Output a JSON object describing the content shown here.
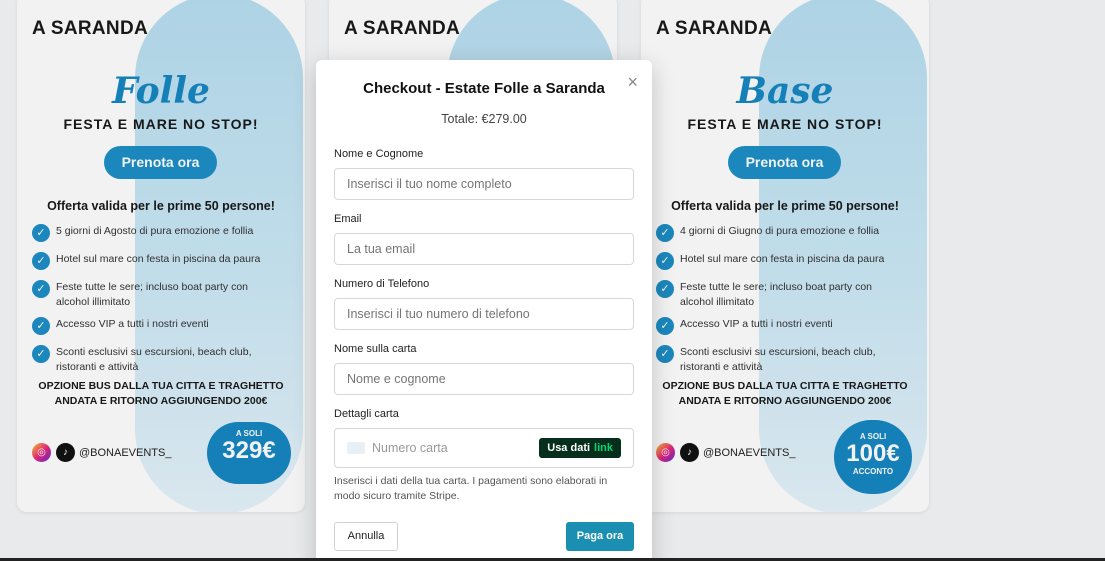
{
  "cards": [
    {
      "head": "A SARANDA",
      "script_title": "Folle",
      "tagline": "FESTA E MARE NO STOP!",
      "cta": "Prenota ora",
      "offer": "Offerta valida per le prime 50 persone!",
      "features": [
        "5 giorni di Agosto di pura emozione e follia",
        "Hotel sul mare con festa in piscina da paura",
        "Feste tutte le sere; incluso boat party con alcohol illimitato",
        "Accesso VIP a tutti i nostri eventi",
        "Sconti esclusivi su escursioni, beach club, ristoranti e attività"
      ],
      "bus": "OPZIONE BUS DALLA TUA CITTA E TRAGHETTO ANDATA E RITORNO AGGIUNGENDO 200€",
      "social": "@BONAEVENTS_",
      "price_small": "A SOLI",
      "price": "329€",
      "price_sub": ""
    },
    {
      "head": "A SARANDA"
    },
    {
      "head": "A SARANDA",
      "script_title": "Base",
      "tagline": "FESTA E MARE NO STOP!",
      "cta": "Prenota ora",
      "offer": "Offerta valida per le prime 50 persone!",
      "features": [
        "4 giorni di Giugno di pura emozione e follia",
        "Hotel sul mare con festa in piscina da paura",
        "Feste tutte le sere; incluso boat party con alcohol illimitato",
        "Accesso VIP a tutti i nostri eventi",
        "Sconti esclusivi su escursioni, beach club, ristoranti e attività"
      ],
      "bus": "OPZIONE BUS DALLA TUA CITTA E TRAGHETTO ANDATA E RITORNO AGGIUNGENDO 200€",
      "social": "@BONAEVENTS_",
      "price_small": "A SOLI",
      "price": "100€",
      "price_sub": "ACCONTO"
    }
  ],
  "modal": {
    "title": "Checkout - Estate Folle a Saranda",
    "close_icon": "×",
    "total": "Totale: €279.00",
    "fields": {
      "name": {
        "label": "Nome e Cognome",
        "placeholder": "Inserisci il tuo nome completo"
      },
      "email": {
        "label": "Email",
        "placeholder": "La tua email"
      },
      "phone": {
        "label": "Numero di Telefono",
        "placeholder": "Inserisci il tuo numero di telefono"
      },
      "cardholder": {
        "label": "Nome sulla carta",
        "placeholder": "Nome e cognome"
      },
      "card": {
        "label": "Dettagli carta",
        "placeholder": "Numero carta",
        "link_prefix": "Usa dati",
        "link_brand": "link"
      }
    },
    "hint": "Inserisci i dati della tua carta. I pagamenti sono elaborati in modo sicuro tramite Stripe.",
    "cancel": "Annulla",
    "pay": "Paga ora"
  }
}
